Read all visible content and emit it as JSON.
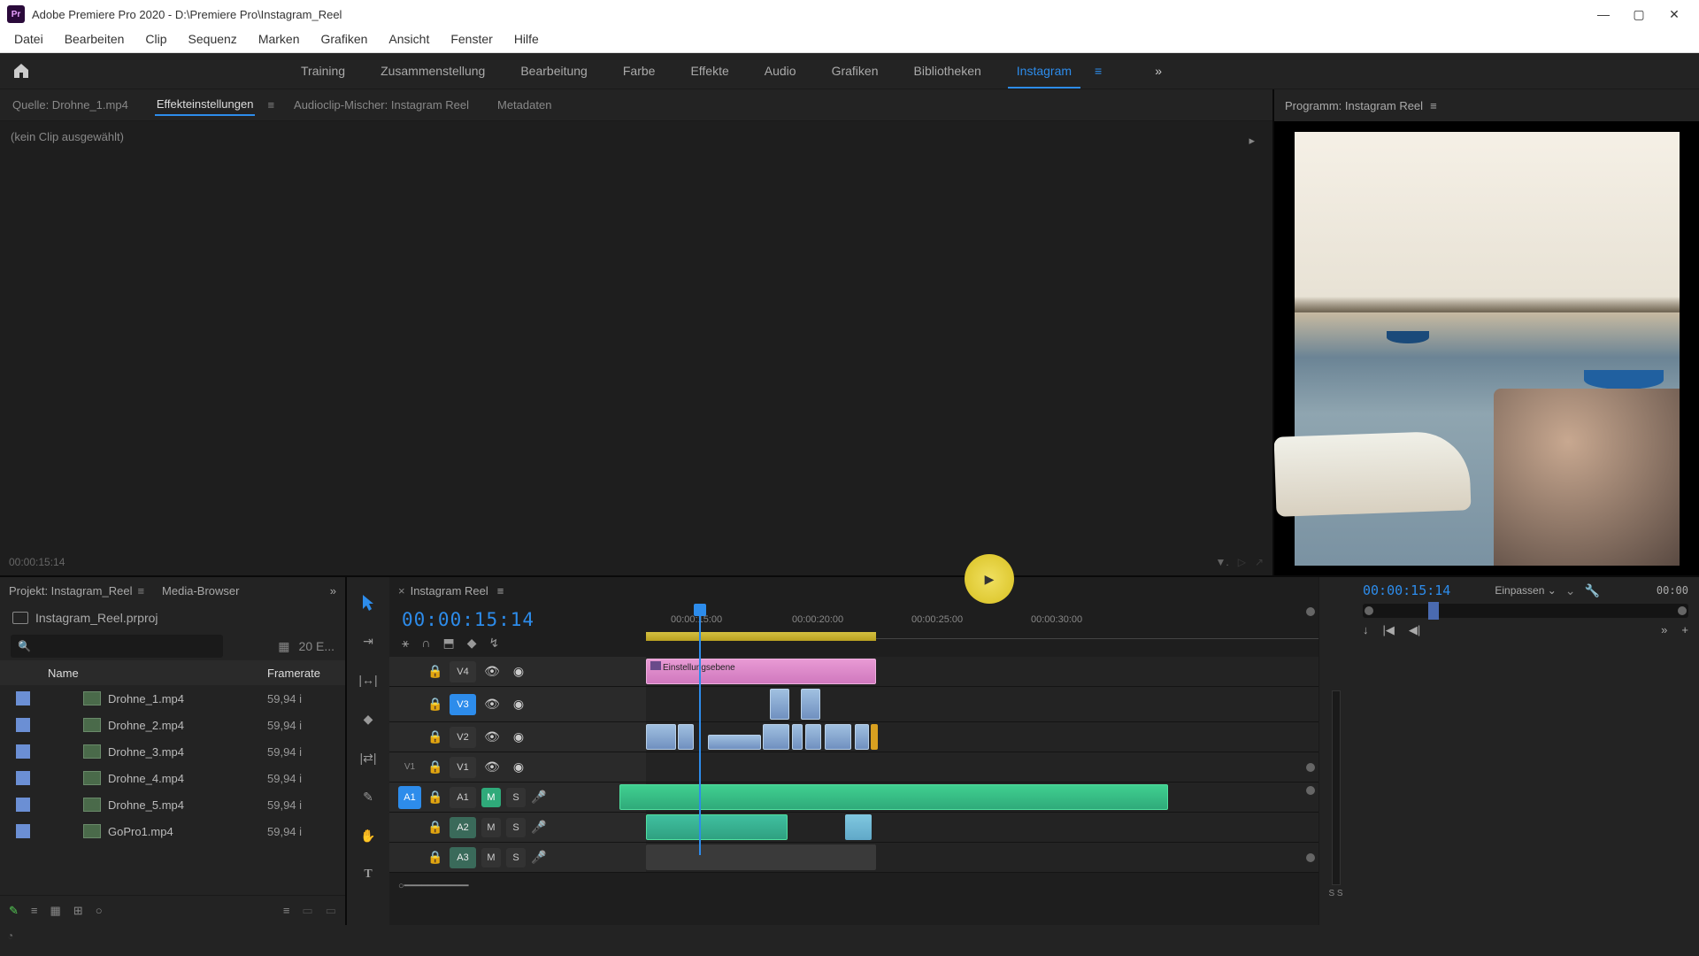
{
  "titlebar": {
    "app": "Adobe Premiere Pro 2020",
    "file": "D:\\Premiere Pro\\Instagram_Reel"
  },
  "menu": [
    "Datei",
    "Bearbeiten",
    "Clip",
    "Sequenz",
    "Marken",
    "Grafiken",
    "Ansicht",
    "Fenster",
    "Hilfe"
  ],
  "workspaces": [
    "Training",
    "Zusammenstellung",
    "Bearbeitung",
    "Farbe",
    "Effekte",
    "Audio",
    "Grafiken",
    "Bibliotheken",
    "Instagram"
  ],
  "active_workspace": "Instagram",
  "source": {
    "tabs": [
      {
        "label": "Quelle: Drohne_1.mp4",
        "active": false
      },
      {
        "label": "Effekteinstellungen",
        "active": true
      },
      {
        "label": "Audioclip-Mischer: Instagram Reel",
        "active": false
      },
      {
        "label": "Metadaten",
        "active": false
      }
    ],
    "body_text": "(kein Clip ausgewählt)",
    "footer_tc": "00:00:15:14"
  },
  "program": {
    "title": "Programm: Instagram Reel",
    "timecode": "00:00:15:14",
    "fit": "Einpassen",
    "timecode2": "00:00"
  },
  "project": {
    "tabs": [
      {
        "label": "Projekt: Instagram_Reel",
        "active": true
      },
      {
        "label": "Media-Browser",
        "active": false
      }
    ],
    "filename": "Instagram_Reel.prproj",
    "item_count": "20 E...",
    "columns": {
      "name": "Name",
      "fr": "Framerate"
    },
    "items": [
      {
        "name": "Drohne_1.mp4",
        "fr": "59,94 i"
      },
      {
        "name": "Drohne_2.mp4",
        "fr": "59,94 i"
      },
      {
        "name": "Drohne_3.mp4",
        "fr": "59,94 i"
      },
      {
        "name": "Drohne_4.mp4",
        "fr": "59,94 i"
      },
      {
        "name": "Drohne_5.mp4",
        "fr": "59,94 i"
      },
      {
        "name": "GoPro1.mp4",
        "fr": "59,94 i"
      }
    ]
  },
  "timeline": {
    "sequence_name": "Instagram Reel",
    "timecode": "00:00:15:14",
    "ruler": [
      "00:00:15:00",
      "00:00:20:00",
      "00:00:25:00",
      "00:00:30:00"
    ],
    "adjustment_label": "Einstellungsebene",
    "tracks": {
      "v4": "V4",
      "v3": "V3",
      "v2": "V2",
      "v1": "V1",
      "a1": "A1",
      "a2": "A2",
      "a3": "A3",
      "src_v1": "V1",
      "src_a1": "A1"
    },
    "btn": {
      "m": "M",
      "s": "S"
    },
    "meter_label": "S S"
  }
}
